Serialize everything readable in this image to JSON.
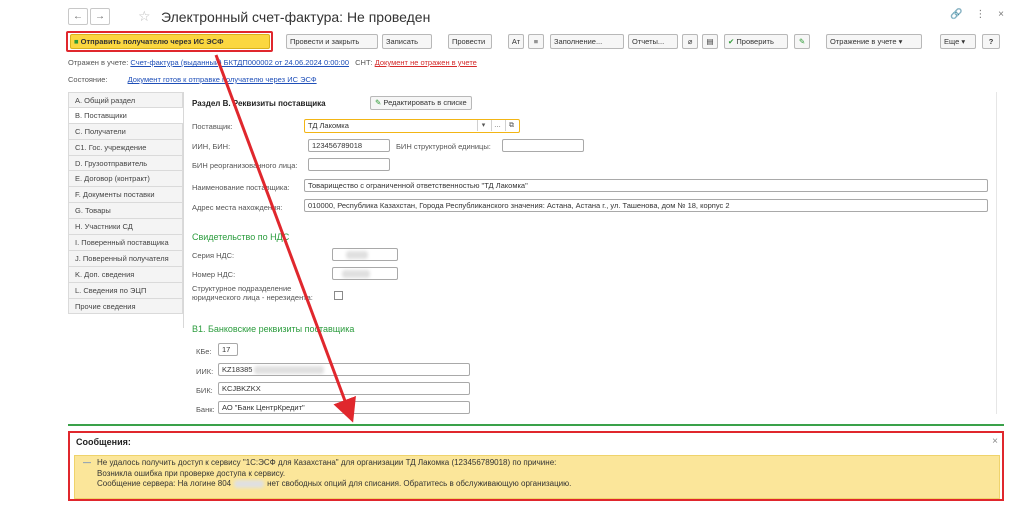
{
  "window": {
    "title": "Электронный счет-фактура: Не проведен",
    "back_icon": "arrow-left-icon",
    "forward_icon": "arrow-right-icon",
    "link_icon": "link-icon",
    "menu_icon": "more-icon",
    "close_icon": "close-icon",
    "back_glyph": "←",
    "forward_glyph": "→",
    "star_glyph": "☆",
    "link_glyph": "🔗",
    "menu_glyph": "⋮",
    "close_glyph": "×"
  },
  "toolbar": {
    "send_label": "Отправить получателю через ИС ЭСФ",
    "post_close_label": "Провести и закрыть",
    "save_label": "Записать",
    "post_label": "Провести",
    "fill_label": "Заполнение...",
    "reports_label": "Отчеты...",
    "check_label": "Проверить",
    "accounting_label": "Отражение в учете",
    "more_label": "Еще",
    "help_label": "?",
    "dropdown_glyph": "▾",
    "check_glyph": "✔",
    "pencil_glyph": "✎",
    "attach_glyph": "⌀",
    "grid_glyph": "▤",
    "list_glyph": "≡",
    "dt_glyph": "Ат"
  },
  "info": {
    "reflected_label": "Отражен в учете:",
    "reflected_link": "Счет-фактура (выданный) БКТДП000002 от 24.06.2024 0:00:00",
    "snt_label": "СНТ:",
    "snt_link": "Документ не отражен в учете",
    "state_label": "Состояние:",
    "state_link": "Документ готов к отправке получателю через ИС ЭСФ"
  },
  "sidebar": {
    "items": [
      {
        "label": "A. Общий раздел"
      },
      {
        "label": "B. Поставщики"
      },
      {
        "label": "C. Получатели"
      },
      {
        "label": "C1. Гос. учреждение"
      },
      {
        "label": "D. Грузоотправитель"
      },
      {
        "label": "E. Договор (контракт)"
      },
      {
        "label": "F. Документы поставки"
      },
      {
        "label": "G. Товары"
      },
      {
        "label": "H. Участники СД"
      },
      {
        "label": "I. Поверенный поставщика"
      },
      {
        "label": "J. Поверенный получателя"
      },
      {
        "label": "K. Доп. сведения"
      },
      {
        "label": "L. Сведения по ЭЦП"
      },
      {
        "label": "Прочие сведения"
      }
    ]
  },
  "form": {
    "section_title": "Раздел В. Реквизиты поставщика",
    "edit_button": "Редактировать в списке",
    "supplier_label": "Поставщик:",
    "supplier_value": "ТД Лакомка",
    "iin_label": "ИИН, БИН:",
    "iin_value": "123456789018",
    "bin_struct_label": "БИН структурной единицы:",
    "bin_reorg_label": "БИН реорганизованного лица:",
    "name_label": "Наименование поставщика:",
    "name_value": "Товарищество с ограниченной ответственностью \"ТД Лакомка\"",
    "address_label": "Адрес места нахождения:",
    "address_value": "010000, Республика Казахстан, Города Республиканского значения: Астана, Астана г., ул. Ташенова, дом № 18, корпус 2",
    "vat_title": "Свидетельство по НДС",
    "vat_series_label": "Серия НДС:",
    "vat_number_label": "Номер НДС:",
    "struct_label_1": "Структурное подразделение",
    "struct_label_2": "юридического лица - нерезидента:",
    "bank_title": "В1. Банковские реквизиты поставщика",
    "kbe_label": "КБе:",
    "kbe_value": "17",
    "iik_label": "ИИК:",
    "iik_value": "KZ18385",
    "bik_label": "БИК:",
    "bik_value": "KCJBKZKX",
    "bank_label": "Банк:",
    "bank_value": "АО \"Банк ЦентрКредит\""
  },
  "messages": {
    "title": "Сообщения:",
    "close_glyph": "×",
    "dash": "—",
    "line1": "Не удалось получить доступ к сервису \"1С:ЭСФ для Казахстана\" для организации ТД Лакомка (123456789018) по причине:",
    "line2": "Возникла ошибка при проверке доступа к сервису.",
    "line3_a": "Сообщение сервера: На логине 804",
    "line3_b": "нет свободных опций для списания. Обратитесь в обслуживающую организацию."
  },
  "colors": {
    "accent_yellow": "#fbd740",
    "annotation_red": "#e0272d",
    "section_green": "#2b9c3d",
    "link_blue": "#1f4fb8"
  }
}
